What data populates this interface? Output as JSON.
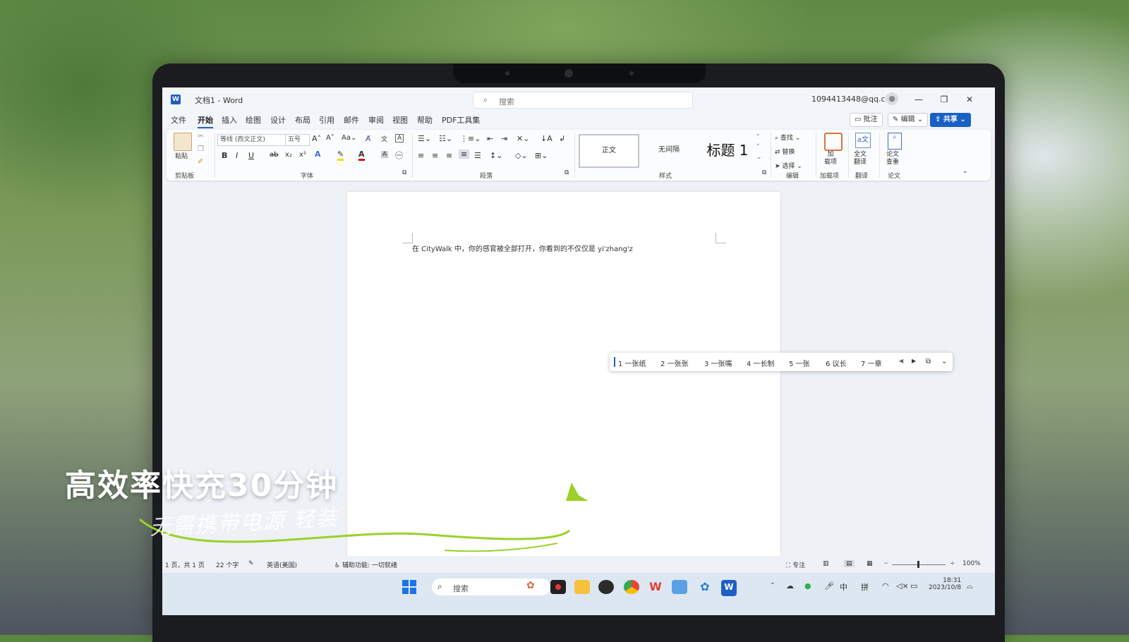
{
  "window": {
    "app_badge": "W",
    "title": "文档1  -  Word",
    "search_placeholder": "搜索",
    "account": "1094413448@qq.com",
    "controls": [
      "—",
      "❐",
      "✕"
    ]
  },
  "menu": {
    "tabs": [
      "文件",
      "开始",
      "插入",
      "绘图",
      "设计",
      "布局",
      "引用",
      "邮件",
      "审阅",
      "视图",
      "帮助",
      "PDF工具集"
    ],
    "active_tab": "开始",
    "comment_button": "批注",
    "edit_button": "编辑",
    "share_button": "共享"
  },
  "ribbon": {
    "clipboard": {
      "paste": "粘贴",
      "label": "剪贴板"
    },
    "font": {
      "font_name": "等线 (西文正文)",
      "font_size": "五号",
      "label": "字体",
      "buttons": [
        "B",
        "I",
        "U",
        "ab",
        "x₂",
        "x²"
      ]
    },
    "paragraph": {
      "label": "段落"
    },
    "styles": {
      "normal": "正文",
      "no_spacing": "无间隔",
      "heading1": "标题 1",
      "label": "样式"
    },
    "editing": {
      "find": "查找",
      "replace": "替换",
      "select": "选择",
      "label": "编辑"
    },
    "addins": {
      "button": "加\n载项",
      "label": "加载项"
    },
    "translate": {
      "button": "全文\n翻译",
      "label": "翻译"
    },
    "paper": {
      "button": "论文\n查重",
      "label": "论文"
    }
  },
  "document": {
    "text": "在 CityWalk 中，你的感官被全部打开，你看到的不仅仅是 yi'zhang'z"
  },
  "ime": {
    "candidates": [
      "1 一张纸",
      "2 一张张",
      "3 一张嘴",
      "4 一长制",
      "5 一张",
      "6 议长",
      "7 一章"
    ]
  },
  "status": {
    "page": "第 1 页，共 1 页",
    "words": "22 个字",
    "language": "英语(美国)",
    "accessibility": "辅助功能: 一切就绪",
    "focus": "专注",
    "zoom": "100%"
  },
  "taskbar": {
    "search_placeholder": "搜索",
    "ime_mode": "中",
    "ime_pinyin": "拼",
    "time": "18:31",
    "date": "2023/10/8"
  },
  "overlay": {
    "headline": "高效率快充30分钟",
    "subline": "无需携带电源 轻装"
  },
  "colors": {
    "word_blue": "#1d5fc5",
    "accent_green": "#9bd12a"
  }
}
